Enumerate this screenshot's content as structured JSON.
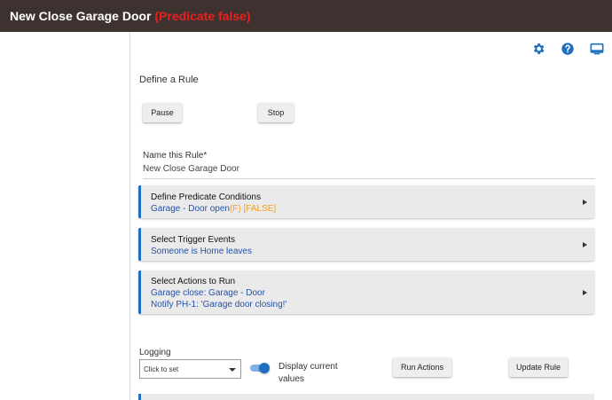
{
  "header": {
    "title": "New Close Garage Door",
    "predicate_status": "(Predicate false)"
  },
  "toolbar": {
    "settings_icon": "gear-icon",
    "help_icon": "help-icon",
    "display_icon": "monitor-icon"
  },
  "page": {
    "section_title": "Define a Rule",
    "pause_label": "Pause",
    "stop_label": "Stop"
  },
  "rule_name": {
    "label": "Name this Rule*",
    "value": "New Close Garage Door"
  },
  "cards": {
    "predicate": {
      "title": "Define Predicate Conditions",
      "condition": "Garage - Door open",
      "state": "(F) [FALSE]"
    },
    "triggers": {
      "title": "Select Trigger Events",
      "line1": "Someone is Home leaves"
    },
    "actions": {
      "title": "Select Actions to Run",
      "line1": "Garage close: Garage - Door",
      "line2": "Notify PH-1: 'Garage door closing!'"
    }
  },
  "logging": {
    "label": "Logging",
    "select_value": "Click to set"
  },
  "display_toggle": {
    "label": "Display current values",
    "on": true
  },
  "footer_buttons": {
    "run_actions": "Run Actions",
    "update_rule": "Update Rule"
  },
  "colors": {
    "header_bg": "#3e3230",
    "predicate_red": "#e8201f",
    "accent_blue": "#1e6fbf",
    "link_blue": "#2452a8",
    "orange": "#f0a020"
  }
}
